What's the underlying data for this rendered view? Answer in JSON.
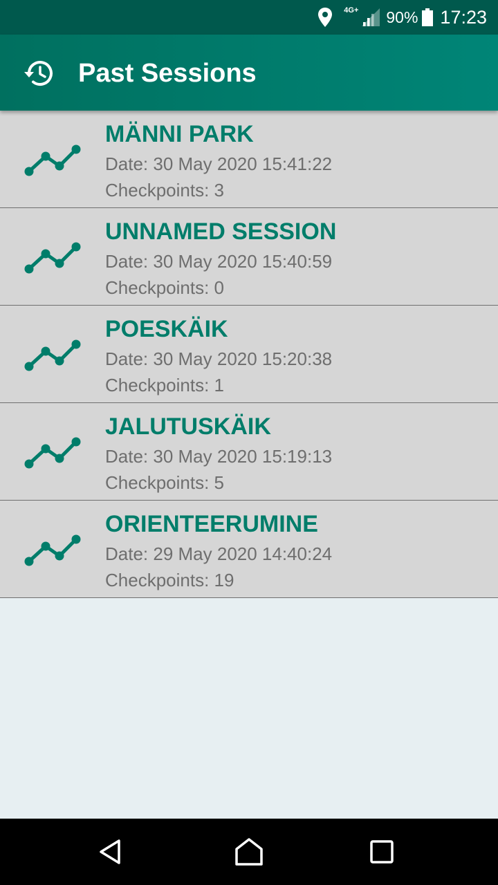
{
  "status_bar": {
    "network": "4G+",
    "battery": "90%",
    "time": "17:23",
    "icons": [
      "location-icon",
      "signal-icon",
      "battery-icon"
    ]
  },
  "app_bar": {
    "title": "Past Sessions",
    "icon": "history-icon"
  },
  "colors": {
    "status_bar": "#00594d",
    "app_bar": "#008577",
    "accent": "#007d6a",
    "row_background": "#d6d6d6",
    "page_background": "#e7eff2"
  },
  "sessions": [
    {
      "name": "MÄNNI PARK",
      "date": "Date: 30 May 2020 15:41:22",
      "checkpoints": "Checkpoints: 3"
    },
    {
      "name": "UNNAMED SESSION",
      "date": "Date: 30 May 2020 15:40:59",
      "checkpoints": "Checkpoints: 0"
    },
    {
      "name": "POESKÄIK",
      "date": "Date: 30 May 2020 15:20:38",
      "checkpoints": "Checkpoints: 1"
    },
    {
      "name": "JALUTUSKÄIK",
      "date": "Date: 30 May 2020 15:19:13",
      "checkpoints": "Checkpoints: 5"
    },
    {
      "name": "ORIENTEERUMINE",
      "date": "Date: 29 May 2020 14:40:24",
      "checkpoints": "Checkpoints: 19"
    }
  ],
  "nav_bar": {
    "icons": [
      "back-icon",
      "home-icon",
      "recents-icon"
    ]
  }
}
